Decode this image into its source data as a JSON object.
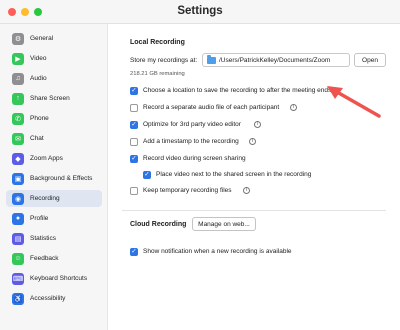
{
  "window": {
    "title": "Settings"
  },
  "sidebar": {
    "items": [
      {
        "label": "General",
        "icon": "gear-icon",
        "color": "#8e8e93",
        "active": false
      },
      {
        "label": "Video",
        "icon": "video-icon",
        "color": "#34c759",
        "active": false
      },
      {
        "label": "Audio",
        "icon": "headphones-icon",
        "color": "#8e8e93",
        "active": false
      },
      {
        "label": "Share Screen",
        "icon": "share-screen-icon",
        "color": "#34c759",
        "active": false
      },
      {
        "label": "Phone",
        "icon": "phone-icon",
        "color": "#34c759",
        "active": false
      },
      {
        "label": "Chat",
        "icon": "chat-icon",
        "color": "#34c759",
        "active": false
      },
      {
        "label": "Zoom Apps",
        "icon": "apps-icon",
        "color": "#5e5ce6",
        "active": false
      },
      {
        "label": "Background & Effects",
        "icon": "background-icon",
        "color": "#2d75e6",
        "active": false
      },
      {
        "label": "Recording",
        "icon": "record-icon",
        "color": "#2d75e6",
        "active": true
      },
      {
        "label": "Profile",
        "icon": "profile-icon",
        "color": "#2d75e6",
        "active": false
      },
      {
        "label": "Statistics",
        "icon": "statistics-icon",
        "color": "#5e5ce6",
        "active": false
      },
      {
        "label": "Feedback",
        "icon": "feedback-icon",
        "color": "#34c759",
        "active": false
      },
      {
        "label": "Keyboard Shortcuts",
        "icon": "keyboard-icon",
        "color": "#5e5ce6",
        "active": false
      },
      {
        "label": "Accessibility",
        "icon": "accessibility-icon",
        "color": "#2d75e6",
        "active": false
      }
    ]
  },
  "local": {
    "title": "Local Recording",
    "store_label": "Store my recordings at:",
    "path": "/Users/PatrickKelley/Documents/Zoom",
    "open_label": "Open",
    "remaining": "218.21 GB remaining",
    "options": [
      {
        "label": "Choose a location to save the recording to after the meeting ends",
        "checked": true,
        "info": false
      },
      {
        "label": "Record a separate audio file of each participant",
        "checked": false,
        "info": true
      },
      {
        "label": "Optimize for 3rd party video editor",
        "checked": true,
        "info": true
      },
      {
        "label": "Add a timestamp to the recording",
        "checked": false,
        "info": true
      },
      {
        "label": "Record video during screen sharing",
        "checked": true,
        "info": false
      },
      {
        "label": "Place video next to the shared screen in the recording",
        "checked": true,
        "info": false
      },
      {
        "label": "Keep temporary recording files",
        "checked": false,
        "info": true
      }
    ]
  },
  "cloud": {
    "title": "Cloud Recording",
    "manage_label": "Manage on web...",
    "options": [
      {
        "label": "Show notification when a new recording is available",
        "checked": true
      }
    ]
  },
  "colors": {
    "accent": "#2d75e6",
    "annotation_arrow": "#ef5350"
  }
}
